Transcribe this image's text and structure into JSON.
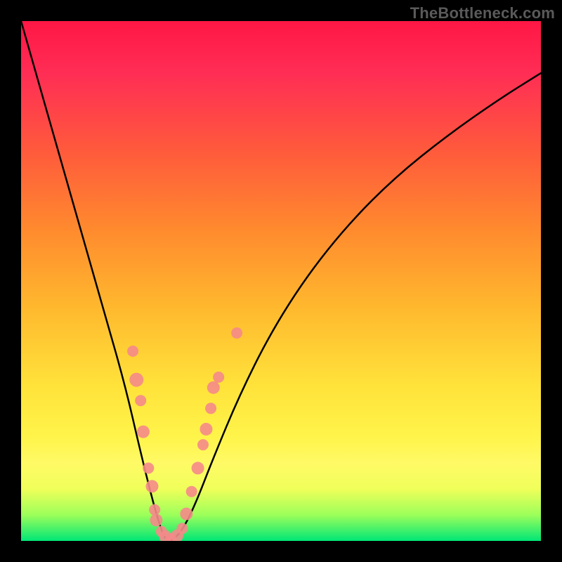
{
  "watermark": "TheBottleneck.com",
  "chart_data": {
    "type": "line",
    "title": "",
    "xlabel": "",
    "ylabel": "",
    "xlim": [
      0,
      1
    ],
    "ylim": [
      0,
      1
    ],
    "series": [
      {
        "name": "bottleneck-curve",
        "x": [
          0.0,
          0.04,
          0.08,
          0.12,
          0.16,
          0.2,
          0.23,
          0.255,
          0.27,
          0.28,
          0.29,
          0.31,
          0.335,
          0.37,
          0.42,
          0.48,
          0.55,
          0.63,
          0.72,
          0.82,
          0.92,
          1.0
        ],
        "y": [
          1.0,
          0.86,
          0.72,
          0.58,
          0.44,
          0.3,
          0.17,
          0.07,
          0.02,
          0.0,
          0.0,
          0.02,
          0.07,
          0.16,
          0.28,
          0.4,
          0.51,
          0.61,
          0.7,
          0.78,
          0.85,
          0.9
        ]
      }
    ],
    "scatter_points": {
      "name": "sample-points",
      "color": "#f58a8a",
      "points": [
        {
          "x": 0.215,
          "y": 0.365,
          "r": 8
        },
        {
          "x": 0.222,
          "y": 0.31,
          "r": 10
        },
        {
          "x": 0.23,
          "y": 0.27,
          "r": 8
        },
        {
          "x": 0.235,
          "y": 0.21,
          "r": 9
        },
        {
          "x": 0.245,
          "y": 0.14,
          "r": 8
        },
        {
          "x": 0.252,
          "y": 0.105,
          "r": 9
        },
        {
          "x": 0.257,
          "y": 0.06,
          "r": 8
        },
        {
          "x": 0.26,
          "y": 0.04,
          "r": 9
        },
        {
          "x": 0.27,
          "y": 0.018,
          "r": 8
        },
        {
          "x": 0.278,
          "y": 0.008,
          "r": 9
        },
        {
          "x": 0.288,
          "y": 0.004,
          "r": 8
        },
        {
          "x": 0.3,
          "y": 0.01,
          "r": 9
        },
        {
          "x": 0.31,
          "y": 0.024,
          "r": 8
        },
        {
          "x": 0.318,
          "y": 0.052,
          "r": 9
        },
        {
          "x": 0.328,
          "y": 0.095,
          "r": 8
        },
        {
          "x": 0.34,
          "y": 0.14,
          "r": 9
        },
        {
          "x": 0.35,
          "y": 0.185,
          "r": 8
        },
        {
          "x": 0.356,
          "y": 0.215,
          "r": 9
        },
        {
          "x": 0.365,
          "y": 0.255,
          "r": 8
        },
        {
          "x": 0.37,
          "y": 0.295,
          "r": 9
        },
        {
          "x": 0.38,
          "y": 0.315,
          "r": 8
        },
        {
          "x": 0.415,
          "y": 0.4,
          "r": 8
        }
      ]
    },
    "background_gradient": [
      "#ff1744",
      "#ff5a3c",
      "#ffb82e",
      "#fff44a",
      "#9cff5a",
      "#00e676"
    ]
  }
}
